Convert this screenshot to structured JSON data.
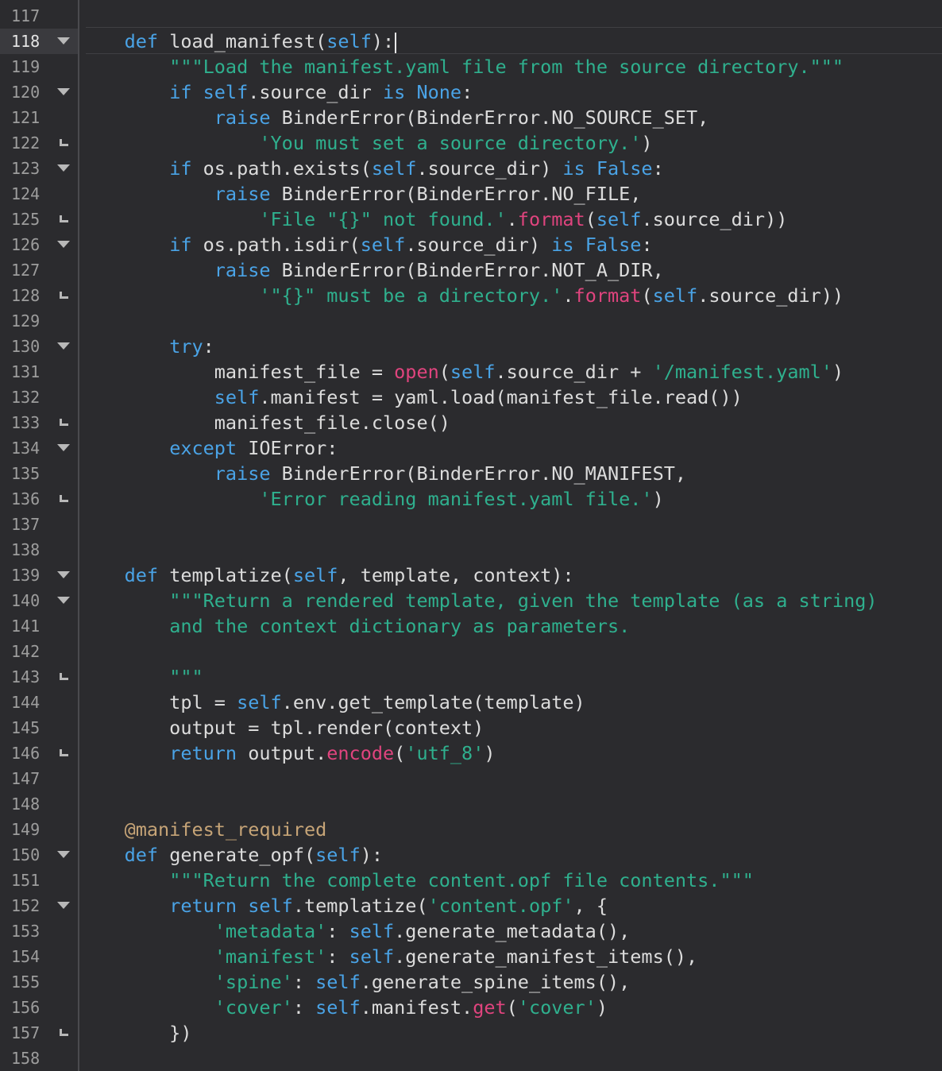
{
  "editor": {
    "current_line": 118,
    "colors": {
      "background": "#2b2b2e",
      "keyword": "#4aa3e6",
      "string": "#2fb08e",
      "builtin": "#e0447e",
      "decorator": "#c6a477",
      "text": "#dcdcdc"
    },
    "lines": [
      {
        "n": "117",
        "fold": "",
        "tokens": []
      },
      {
        "n": "118",
        "fold": "down",
        "tokens": [
          [
            "    ",
            "p"
          ],
          [
            "def",
            "k"
          ],
          [
            " load_manifest(",
            "p"
          ],
          [
            "self",
            "k"
          ],
          [
            "):",
            "p"
          ]
        ]
      },
      {
        "n": "119",
        "fold": "",
        "tokens": [
          [
            "        ",
            "p"
          ],
          [
            "\"\"\"Load the manifest.yaml file from the source directory.\"\"\"",
            "s"
          ]
        ]
      },
      {
        "n": "120",
        "fold": "down",
        "tokens": [
          [
            "        ",
            "p"
          ],
          [
            "if",
            "k"
          ],
          [
            " ",
            "p"
          ],
          [
            "self",
            "k"
          ],
          [
            ".source_dir ",
            "p"
          ],
          [
            "is",
            "k"
          ],
          [
            " ",
            "p"
          ],
          [
            "None",
            "k"
          ],
          [
            ":",
            "p"
          ]
        ]
      },
      {
        "n": "121",
        "fold": "",
        "tokens": [
          [
            "            ",
            "p"
          ],
          [
            "raise",
            "k"
          ],
          [
            " BinderError(BinderError.NO_SOURCE_SET,",
            "p"
          ]
        ]
      },
      {
        "n": "122",
        "fold": "end",
        "tokens": [
          [
            "                ",
            "p"
          ],
          [
            "'You must set a source directory.'",
            "s"
          ],
          [
            ")",
            "p"
          ]
        ]
      },
      {
        "n": "123",
        "fold": "down",
        "tokens": [
          [
            "        ",
            "p"
          ],
          [
            "if",
            "k"
          ],
          [
            " os.path.exists(",
            "p"
          ],
          [
            "self",
            "k"
          ],
          [
            ".source_dir) ",
            "p"
          ],
          [
            "is",
            "k"
          ],
          [
            " ",
            "p"
          ],
          [
            "False",
            "k"
          ],
          [
            ":",
            "p"
          ]
        ]
      },
      {
        "n": "124",
        "fold": "",
        "tokens": [
          [
            "            ",
            "p"
          ],
          [
            "raise",
            "k"
          ],
          [
            " BinderError(BinderError.NO_FILE,",
            "p"
          ]
        ]
      },
      {
        "n": "125",
        "fold": "end",
        "tokens": [
          [
            "                ",
            "p"
          ],
          [
            "'File \"{}\" not found.'",
            "s"
          ],
          [
            ".",
            "p"
          ],
          [
            "format",
            "b"
          ],
          [
            "(",
            "p"
          ],
          [
            "self",
            "k"
          ],
          [
            ".source_dir))",
            "p"
          ]
        ]
      },
      {
        "n": "126",
        "fold": "down",
        "tokens": [
          [
            "        ",
            "p"
          ],
          [
            "if",
            "k"
          ],
          [
            " os.path.isdir(",
            "p"
          ],
          [
            "self",
            "k"
          ],
          [
            ".source_dir) ",
            "p"
          ],
          [
            "is",
            "k"
          ],
          [
            " ",
            "p"
          ],
          [
            "False",
            "k"
          ],
          [
            ":",
            "p"
          ]
        ]
      },
      {
        "n": "127",
        "fold": "",
        "tokens": [
          [
            "            ",
            "p"
          ],
          [
            "raise",
            "k"
          ],
          [
            " BinderError(BinderError.NOT_A_DIR,",
            "p"
          ]
        ]
      },
      {
        "n": "128",
        "fold": "end",
        "tokens": [
          [
            "                ",
            "p"
          ],
          [
            "'\"{}\" must be a directory.'",
            "s"
          ],
          [
            ".",
            "p"
          ],
          [
            "format",
            "b"
          ],
          [
            "(",
            "p"
          ],
          [
            "self",
            "k"
          ],
          [
            ".source_dir))",
            "p"
          ]
        ]
      },
      {
        "n": "129",
        "fold": "",
        "tokens": []
      },
      {
        "n": "130",
        "fold": "down",
        "tokens": [
          [
            "        ",
            "p"
          ],
          [
            "try",
            "k"
          ],
          [
            ":",
            "p"
          ]
        ]
      },
      {
        "n": "131",
        "fold": "",
        "tokens": [
          [
            "            manifest_file = ",
            "p"
          ],
          [
            "open",
            "b"
          ],
          [
            "(",
            "p"
          ],
          [
            "self",
            "k"
          ],
          [
            ".source_dir + ",
            "p"
          ],
          [
            "'/manifest.yaml'",
            "s"
          ],
          [
            ")",
            "p"
          ]
        ]
      },
      {
        "n": "132",
        "fold": "",
        "tokens": [
          [
            "            ",
            "p"
          ],
          [
            "self",
            "k"
          ],
          [
            ".manifest = yaml.load(manifest_file.read())",
            "p"
          ]
        ]
      },
      {
        "n": "133",
        "fold": "end",
        "tokens": [
          [
            "            manifest_file.close()",
            "p"
          ]
        ]
      },
      {
        "n": "134",
        "fold": "down",
        "tokens": [
          [
            "        ",
            "p"
          ],
          [
            "except",
            "k"
          ],
          [
            " IOError:",
            "p"
          ]
        ]
      },
      {
        "n": "135",
        "fold": "",
        "tokens": [
          [
            "            ",
            "p"
          ],
          [
            "raise",
            "k"
          ],
          [
            " BinderError(BinderError.NO_MANIFEST,",
            "p"
          ]
        ]
      },
      {
        "n": "136",
        "fold": "end",
        "tokens": [
          [
            "                ",
            "p"
          ],
          [
            "'Error reading manifest.yaml file.'",
            "s"
          ],
          [
            ")",
            "p"
          ]
        ]
      },
      {
        "n": "137",
        "fold": "",
        "tokens": []
      },
      {
        "n": "138",
        "fold": "",
        "tokens": []
      },
      {
        "n": "139",
        "fold": "down",
        "tokens": [
          [
            "    ",
            "p"
          ],
          [
            "def",
            "k"
          ],
          [
            " templatize(",
            "p"
          ],
          [
            "self",
            "k"
          ],
          [
            ", template, context):",
            "p"
          ]
        ]
      },
      {
        "n": "140",
        "fold": "down",
        "tokens": [
          [
            "        ",
            "p"
          ],
          [
            "\"\"\"Return a rendered template, given the template (as a string)",
            "s"
          ]
        ]
      },
      {
        "n": "141",
        "fold": "",
        "tokens": [
          [
            "        ",
            "p"
          ],
          [
            "and the context dictionary as parameters.",
            "s"
          ]
        ]
      },
      {
        "n": "142",
        "fold": "",
        "tokens": []
      },
      {
        "n": "143",
        "fold": "end",
        "tokens": [
          [
            "        ",
            "p"
          ],
          [
            "\"\"\"",
            "s"
          ]
        ]
      },
      {
        "n": "144",
        "fold": "",
        "tokens": [
          [
            "        tpl = ",
            "p"
          ],
          [
            "self",
            "k"
          ],
          [
            ".env.get_template(template)",
            "p"
          ]
        ]
      },
      {
        "n": "145",
        "fold": "",
        "tokens": [
          [
            "        output = tpl.render(context)",
            "p"
          ]
        ]
      },
      {
        "n": "146",
        "fold": "end",
        "tokens": [
          [
            "        ",
            "p"
          ],
          [
            "return",
            "k"
          ],
          [
            " output.",
            "p"
          ],
          [
            "encode",
            "b"
          ],
          [
            "(",
            "p"
          ],
          [
            "'utf_8'",
            "s"
          ],
          [
            ")",
            "p"
          ]
        ]
      },
      {
        "n": "147",
        "fold": "",
        "tokens": []
      },
      {
        "n": "148",
        "fold": "",
        "tokens": []
      },
      {
        "n": "149",
        "fold": "",
        "tokens": [
          [
            "    ",
            "p"
          ],
          [
            "@manifest_required",
            "d"
          ]
        ]
      },
      {
        "n": "150",
        "fold": "down",
        "tokens": [
          [
            "    ",
            "p"
          ],
          [
            "def",
            "k"
          ],
          [
            " generate_opf(",
            "p"
          ],
          [
            "self",
            "k"
          ],
          [
            "):",
            "p"
          ]
        ]
      },
      {
        "n": "151",
        "fold": "",
        "tokens": [
          [
            "        ",
            "p"
          ],
          [
            "\"\"\"Return the complete content.opf file contents.\"\"\"",
            "s"
          ]
        ]
      },
      {
        "n": "152",
        "fold": "down",
        "tokens": [
          [
            "        ",
            "p"
          ],
          [
            "return",
            "k"
          ],
          [
            " ",
            "p"
          ],
          [
            "self",
            "k"
          ],
          [
            ".templatize(",
            "p"
          ],
          [
            "'content.opf'",
            "s"
          ],
          [
            ", {",
            "p"
          ]
        ]
      },
      {
        "n": "153",
        "fold": "",
        "tokens": [
          [
            "            ",
            "p"
          ],
          [
            "'metadata'",
            "s"
          ],
          [
            ": ",
            "p"
          ],
          [
            "self",
            "k"
          ],
          [
            ".generate_metadata(),",
            "p"
          ]
        ]
      },
      {
        "n": "154",
        "fold": "",
        "tokens": [
          [
            "            ",
            "p"
          ],
          [
            "'manifest'",
            "s"
          ],
          [
            ": ",
            "p"
          ],
          [
            "self",
            "k"
          ],
          [
            ".generate_manifest_items(),",
            "p"
          ]
        ]
      },
      {
        "n": "155",
        "fold": "",
        "tokens": [
          [
            "            ",
            "p"
          ],
          [
            "'spine'",
            "s"
          ],
          [
            ": ",
            "p"
          ],
          [
            "self",
            "k"
          ],
          [
            ".generate_spine_items(),",
            "p"
          ]
        ]
      },
      {
        "n": "156",
        "fold": "",
        "tokens": [
          [
            "            ",
            "p"
          ],
          [
            "'cover'",
            "s"
          ],
          [
            ": ",
            "p"
          ],
          [
            "self",
            "k"
          ],
          [
            ".manifest.",
            "p"
          ],
          [
            "get",
            "b"
          ],
          [
            "(",
            "p"
          ],
          [
            "'cover'",
            "s"
          ],
          [
            ")",
            "p"
          ]
        ]
      },
      {
        "n": "157",
        "fold": "end",
        "tokens": [
          [
            "        })",
            "p"
          ]
        ]
      },
      {
        "n": "158",
        "fold": "",
        "tokens": []
      }
    ]
  }
}
